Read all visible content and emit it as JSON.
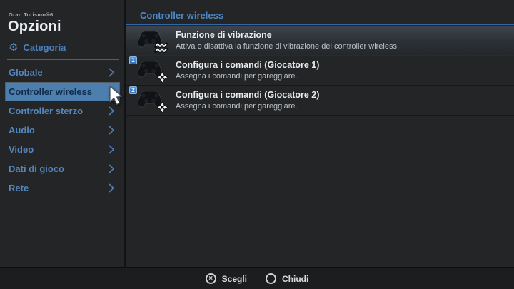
{
  "app": {
    "brand": "Gran Turismo®6",
    "title": "Opzioni"
  },
  "sidebar": {
    "category_label": "Categoria",
    "items": [
      {
        "label": "Globale",
        "selected": false
      },
      {
        "label": "Controller wireless",
        "selected": true
      },
      {
        "label": "Controller sterzo",
        "selected": false
      },
      {
        "label": "Audio",
        "selected": false
      },
      {
        "label": "Video",
        "selected": false
      },
      {
        "label": "Dati di gioco",
        "selected": false
      },
      {
        "label": "Rete",
        "selected": false
      }
    ]
  },
  "panel": {
    "title": "Controller wireless",
    "items": [
      {
        "title": "Funzione di vibrazione",
        "description": "Attiva o disattiva la funzione di vibrazione del controller wireless.",
        "icon": "gamepad-vibration-icon",
        "badge": "",
        "focused": true
      },
      {
        "title": "Configura i comandi (Giocatore 1)",
        "description": "Assegna i comandi per gareggiare.",
        "icon": "gamepad-dpad-icon",
        "badge": "1",
        "focused": false
      },
      {
        "title": "Configura i comandi (Giocatore 2)",
        "description": "Assegna i comandi per gareggiare.",
        "icon": "gamepad-dpad-icon",
        "badge": "2",
        "focused": false
      }
    ]
  },
  "footer": {
    "buttons": [
      {
        "icon": "cross-button-icon",
        "glyph": "×",
        "label": "Scegli"
      },
      {
        "icon": "circle-button-icon",
        "glyph": "",
        "label": "Chiudi"
      }
    ]
  },
  "colors": {
    "accent_blue": "#4c87c9",
    "selected_item_bg": "#4d7fae",
    "selected_item_text": "#0f2c4c",
    "background": "#232527",
    "bottom_bar_bg": "#1b1d1e"
  }
}
